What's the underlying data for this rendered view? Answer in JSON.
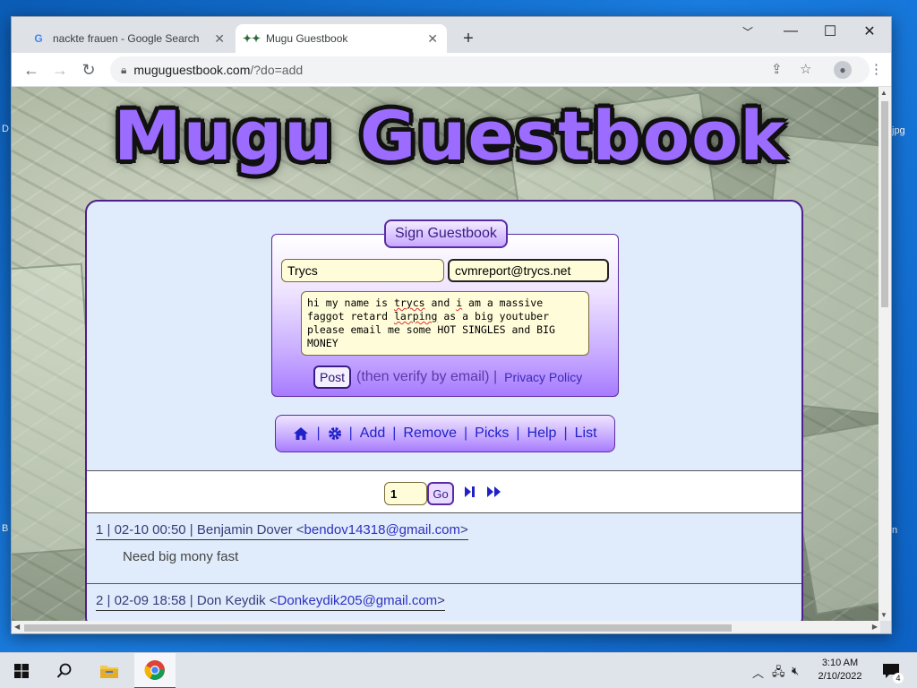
{
  "desktop": {
    "left_fragment_1": "D",
    "left_fragment_2": "B",
    "right_fragment_1": "jpg",
    "right_fragment_2": "n"
  },
  "browser": {
    "tabs": [
      {
        "icon": "google-g-icon",
        "title": "nackte frauen - Google Search",
        "active": false
      },
      {
        "icon": "mugu-favicon-icon",
        "title": "Mugu Guestbook",
        "active": true
      }
    ],
    "url_host": "muguguestbook.com",
    "url_path": "/?do=add"
  },
  "site": {
    "title": "Mugu Guestbook",
    "sign_legend": "Sign Guestbook",
    "form": {
      "name_value": "Trycs",
      "email_value": "cvmreport@trycs.net",
      "message_value": "hi my name is trycs and i am a massive faggot retard larping as a big youtuber please email me some HOT SINGLES and BIG MONEY",
      "post_label": "Post",
      "verify_text": "(then verify by email) |",
      "privacy_label": "Privacy Policy"
    },
    "nav": {
      "add": "Add",
      "remove": "Remove",
      "picks": "Picks",
      "help": "Help",
      "list": "List",
      "separator": "|"
    },
    "pager": {
      "page_value": "1",
      "go_label": "Go"
    },
    "entries": [
      {
        "head_prefix": "1 | 02-10 00:50 | Benjamin Dover <",
        "email": "bendov14318@gmail.com",
        "head_suffix": ">",
        "message": "Need big mony fast"
      },
      {
        "head_prefix": "2 | 02-09 18:58 | Don Keydik <",
        "email": "Donkeydik205@gmail.com",
        "head_suffix": ">",
        "message": ""
      }
    ]
  },
  "taskbar": {
    "time": "3:10 AM",
    "date": "2/10/2022",
    "notification_count": "4"
  }
}
